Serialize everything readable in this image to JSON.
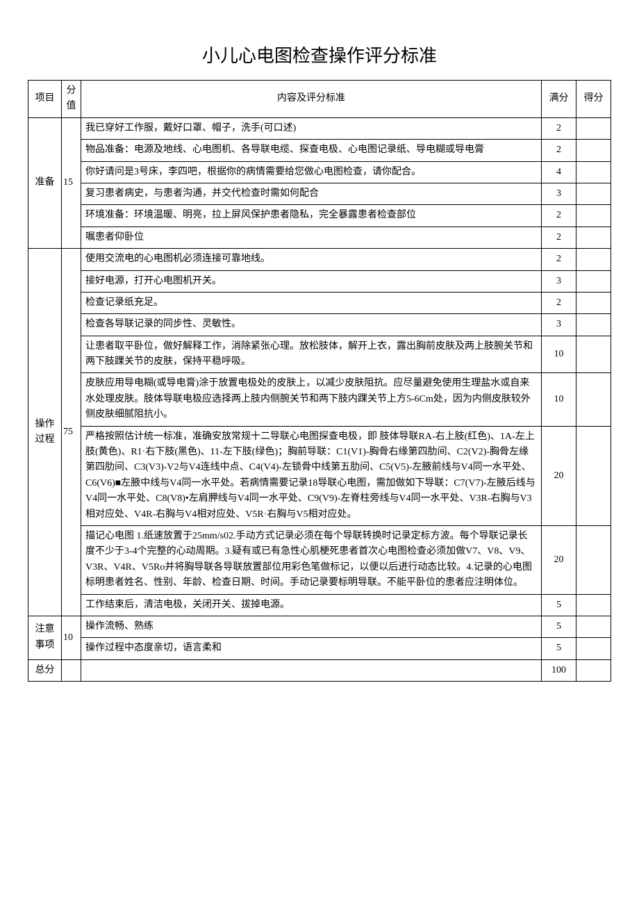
{
  "title": "小儿心电图检查操作评分标准",
  "headers": {
    "category": "项目",
    "value": "分值",
    "content": "内容及评分标准",
    "full": "满分",
    "score": "得分"
  },
  "sections": [
    {
      "category": "准备",
      "value": "15",
      "rows": [
        {
          "content": "我已穿好工作服，戴好口罩、帽子，洗手(可口述)",
          "full": "2"
        },
        {
          "content": "物品准备：电源及地线、心电图机、各导联电缆、探查电极、心电图记录纸、导电糊或导电膏",
          "full": "2"
        },
        {
          "content": "你好请问是3号床，李四吧，根据你的病情需要给您做心电图检查，请你配合。",
          "full": "4"
        },
        {
          "content": "复习患者病史，与患者沟通，并交代检查时需如何配合",
          "full": "3"
        },
        {
          "content": "环境准备：环境温暖、明亮，拉上屏风保护患者隐私，完全暴露患者检查部位",
          "full": "2"
        },
        {
          "content": "嘱患者仰卧位",
          "full": "2"
        }
      ]
    },
    {
      "category": "操作过程",
      "value": "75",
      "rows": [
        {
          "content": "使用交流电的心电图机必须连接可靠地线。",
          "full": "2"
        },
        {
          "content": "接好电源，打开心电图机开关。",
          "full": "3"
        },
        {
          "content": "检查记录纸充足。",
          "full": "2"
        },
        {
          "content": "检查各导联记录的同步性、灵敏性。",
          "full": "3"
        },
        {
          "content": "让患者取平卧位，做好解释工作，消除紧张心理。放松肢体，解开上衣，露出胸前皮肤及两上肢腕关节和两下肢踝关节的皮肤，保持平稳呼吸。",
          "full": "10"
        },
        {
          "content": "皮肤应用导电糊(或导电膏)涂于放置电极处的皮肤上，以减少皮肤阻抗。应尽量避免使用生理盐水或自来水处理皮肤。肢体导联电极应选择两上肢内侧腕关节和两下肢内踝关节上方5-6Cm处，因为内侧皮肤较外侧皮肤细腻阻抗小。",
          "full": "10"
        },
        {
          "content": "严格按照估计统一标准，准确安放常规十二导联心电图探查电极，即 肢体导联RA-右上肢(红色)、1A-左上肢(黄色)、R1·右下肢(黑色)、11-左下肢(绿色)；胸前导联：C1(V1)-胸骨右缘第四肋间、C2(V2)-胸骨左缘第四肋间、C3(V3)-V2与V4连线中点、C4(V4)-左锁骨中线第五肋间、C5(V5)-左腋前线与V4同一水平处、C6(V6)■左腋中线与V4同一水平处。若病情需要记录18导联心电图，需加做如下导联：C7(V7)-左腋后线与V4同一水平处、C8(V8)•左肩胛线与V4同一水平处、C9(V9)-左脊柱旁线与V4同一水平处、V3R-右胸与V3相对应处、V4R-右胸与V4相对应处、V5R·右胸与V5相对应处。",
          "full": "20"
        },
        {
          "content": "描记心电图 1.纸速放置于25mm/s02.手动方式记录必须在每个导联转换时记录定标方波。每个导联记录长度不少于3-4个完整的心动周期。3.疑有或已有急性心肌梗死患者首次心电图检查必须加做V7、V8、V9、V3R、V4R、V5Ro并将胸导联各导联放置部位用彩色笔做标记，以便以后进行动态比较。4.记录的心电图标明患者姓名、性别、年龄、检查日期、时间。手动记录要标明导联。不能平卧位的患者应注明体位。",
          "full": "20"
        },
        {
          "content": "工作结束后，清洁电极，关闭开关、拔掉电源。",
          "full": "5"
        }
      ]
    },
    {
      "category": "注意事项",
      "value": "10",
      "rows": [
        {
          "content": "操作流畅、熟练",
          "full": "5"
        },
        {
          "content": "操作过程中态度亲切，语言柔和",
          "full": "5"
        }
      ]
    }
  ],
  "total": {
    "label": "总分",
    "full": "100"
  }
}
